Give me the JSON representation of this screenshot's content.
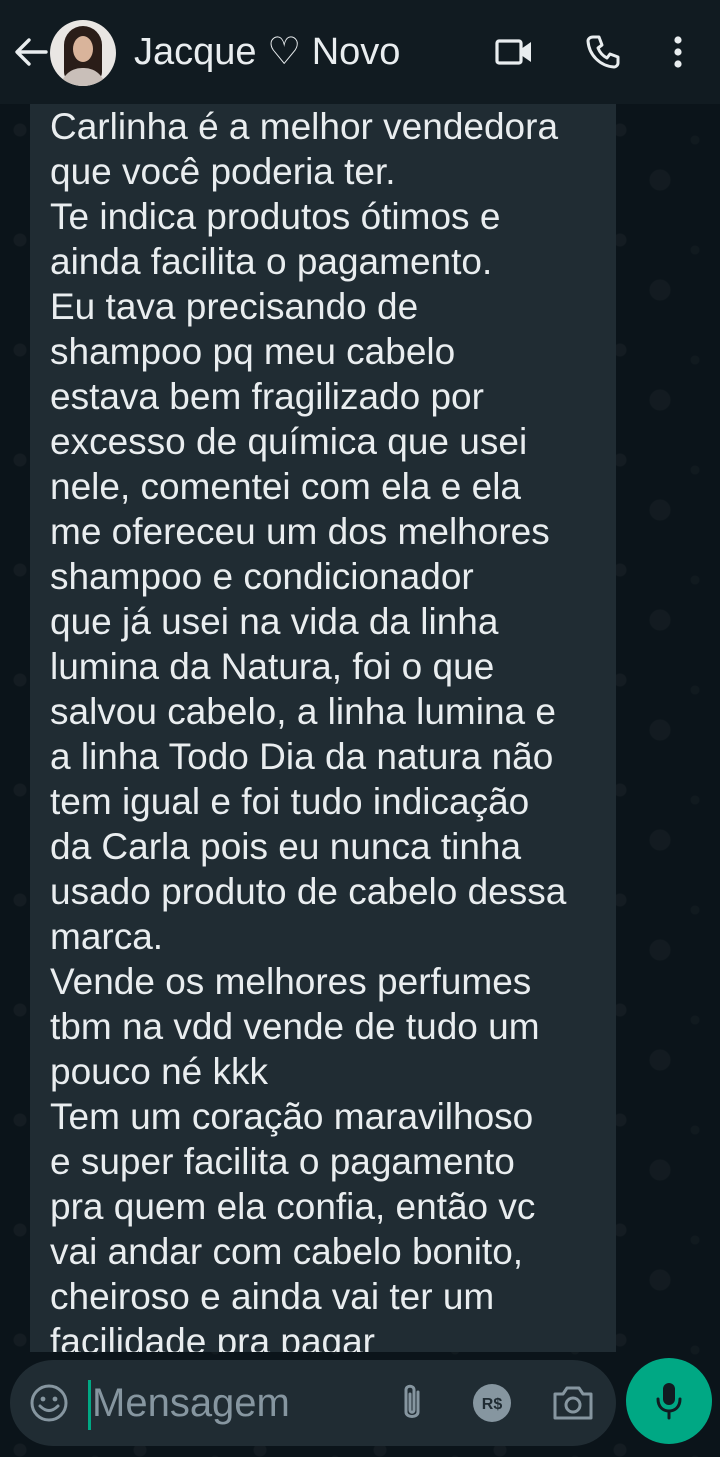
{
  "header": {
    "contact_name": "Jacque ♡ Novo",
    "icons": [
      "back-arrow-icon",
      "video-call-icon",
      "voice-call-icon",
      "more-options-icon"
    ]
  },
  "message": {
    "lines": [
      "Carlinha é a melhor vendedora",
      "que você poderia ter.",
      "Te indica produtos ótimos e",
      "ainda facilita o pagamento.",
      "Eu tava precisando de",
      "shampoo pq meu cabelo",
      "estava bem fragilizado por",
      "excesso de química que usei",
      "nele, comentei com ela e ela",
      "me ofereceu um dos melhores",
      "shampoo e condicionador",
      "que já usei na vida da linha",
      "lumina da Natura, foi o que",
      "salvou cabelo, a linha lumina e",
      "a linha Todo Dia da natura não",
      "tem igual e foi tudo indicação",
      "da Carla pois eu nunca tinha",
      "usado produto de cabelo dessa",
      "marca.",
      "Vende os melhores perfumes",
      "tbm na vdd vende de tudo um",
      "pouco né kkk",
      "Tem um coração maravilhoso",
      "e super facilita o pagamento",
      "pra quem ela confia, então vc",
      "vai andar com cabelo bonito,",
      "cheiroso e ainda vai ter um",
      "facilidade pra pagar"
    ]
  },
  "composer": {
    "placeholder": "Mensagem",
    "pay_label": "R$",
    "icons": [
      "emoji-icon",
      "attach-icon",
      "payment-icon",
      "camera-icon",
      "microphone-icon"
    ]
  },
  "colors": {
    "header_bg": "#111b21",
    "chat_bg": "#0b141a",
    "bubble_bg": "#202c33",
    "text": "#e9edef",
    "placeholder": "#8696a0",
    "accent": "#00a884"
  }
}
